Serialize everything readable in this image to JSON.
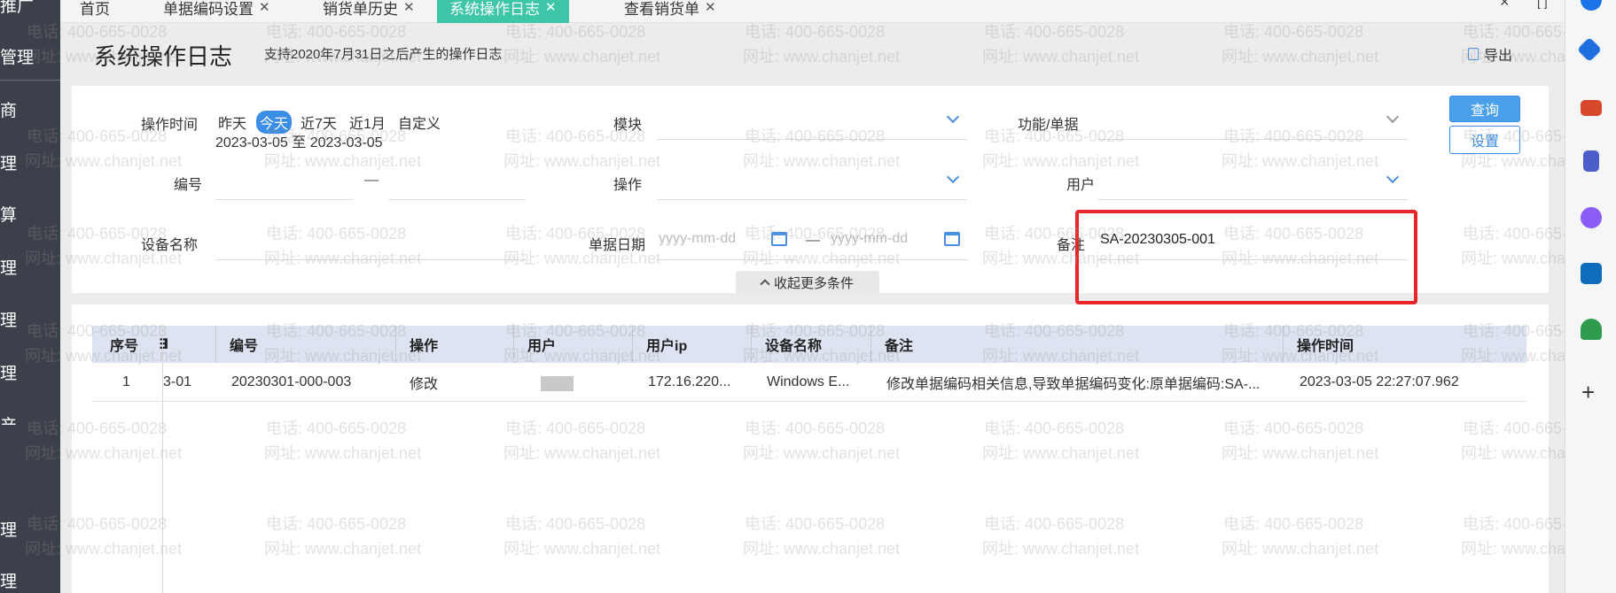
{
  "sidebar": {
    "items": [
      "推广",
      "管理",
      "商",
      "理",
      "算",
      "理",
      "理",
      "理",
      "产",
      "理",
      "理"
    ]
  },
  "tabs": [
    {
      "label": "首页",
      "closable": false,
      "active": false
    },
    {
      "label": "单据编码设置",
      "closable": true,
      "active": false
    },
    {
      "label": "销货单历史",
      "closable": true,
      "active": false
    },
    {
      "label": "系统操作日志",
      "closable": true,
      "active": true
    },
    {
      "label": "查看销货单",
      "closable": true,
      "active": false
    }
  ],
  "window_controls": {
    "close": "×",
    "restore": "[ ]"
  },
  "header": {
    "title": "系统操作日志",
    "subtitle": "支持2020年7月31日之后产生的操作日志",
    "export_label": "导出"
  },
  "filters": {
    "op_time_label": "操作时间",
    "quick_ranges": [
      "昨天",
      "今天",
      "近7天",
      "近1月",
      "自定义"
    ],
    "selected_range": "今天",
    "date_range_text": "2023-03-05 至 2023-03-05",
    "module_label": "模块",
    "function_label": "功能/单据",
    "number_label": "编号",
    "number_sep": "—",
    "operation_label": "操作",
    "user_label": "用户",
    "device_label": "设备名称",
    "doc_date_label": "单据日期",
    "doc_date_start_placeholder": "yyyy-mm-dd",
    "doc_date_sep": "—",
    "doc_date_end_placeholder": "yyyy-mm-dd",
    "remark_label": "备注",
    "remark_value": "SA-20230305-001",
    "query_button": "查询",
    "settings_button": "设置",
    "collapse_label": "收起更多条件"
  },
  "table": {
    "columns": [
      "序号",
      "编号",
      "操作",
      "用户",
      "用户ip",
      "设备名称",
      "备注",
      "操作时间"
    ],
    "rows": [
      {
        "index": "1",
        "partial": "3-01",
        "number": "20230301-000-003",
        "operation": "修改",
        "user": "",
        "ip": "172.16.220...",
        "device": "Windows E...",
        "remark": "修改单据编码相关信息,导致单据编码变化:原单据编码:SA-...",
        "time": "2023-03-05 22:27:07.962"
      }
    ]
  },
  "watermark": {
    "phone": "电话: 400-665-0028",
    "site": "网址: www.chanjet.net"
  },
  "colors": {
    "sidebar_bg": "#3c404a",
    "active_tab": "#3ec6a8",
    "primary": "#4aa0ea",
    "highlight": "#e8262a",
    "table_header": "#dde3f1"
  },
  "rail_icons": [
    "outlook-icon",
    "tag-icon",
    "toolbox-icon",
    "chess-icon",
    "copilot-icon",
    "outlook-mail-icon",
    "tree-icon",
    "add-icon"
  ]
}
